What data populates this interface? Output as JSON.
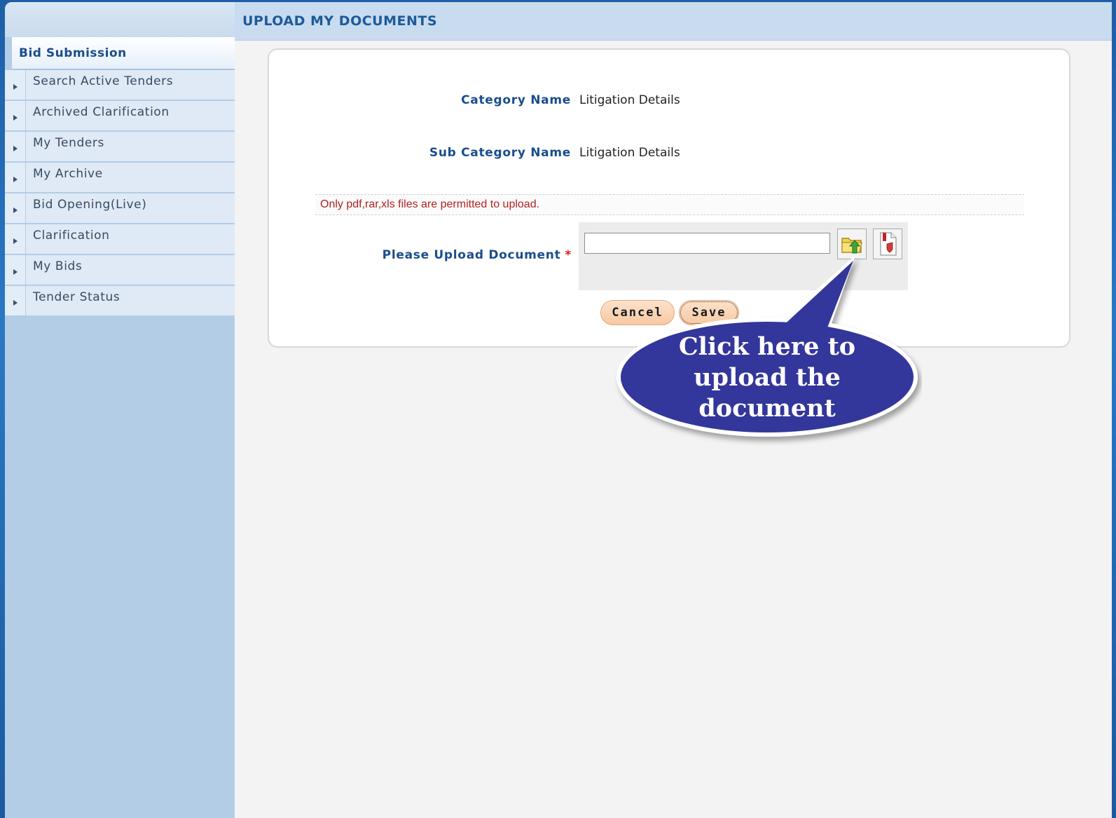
{
  "page": {
    "title": "UPLOAD MY DOCUMENTS"
  },
  "sidebar": {
    "header": "Bid Submission",
    "items": [
      {
        "label": "Search Active Tenders"
      },
      {
        "label": "Archived Clarification"
      },
      {
        "label": "My Tenders"
      },
      {
        "label": "My Archive"
      },
      {
        "label": "Bid Opening(Live)"
      },
      {
        "label": "Clarification"
      },
      {
        "label": "My Bids"
      },
      {
        "label": "Tender Status"
      }
    ]
  },
  "form": {
    "category_label": "Category Name",
    "category_value": "Litigation Details",
    "subcategory_label": "Sub Category Name",
    "subcategory_value": "Litigation Details",
    "note": "Only pdf,rar,xls files are permitted to upload.",
    "upload_label": "Please Upload Document",
    "required_mark": "*",
    "file_value": "",
    "cancel_label": "Cancel",
    "save_label": "Save"
  },
  "callout": {
    "line1": "Click here to",
    "line2": "upload the",
    "line3": "document",
    "color": "#33369a"
  },
  "icons": {
    "browse": "folder-upload-icon",
    "sign": "signed-document-icon",
    "nav_arrow": "arrow-right-icon"
  }
}
